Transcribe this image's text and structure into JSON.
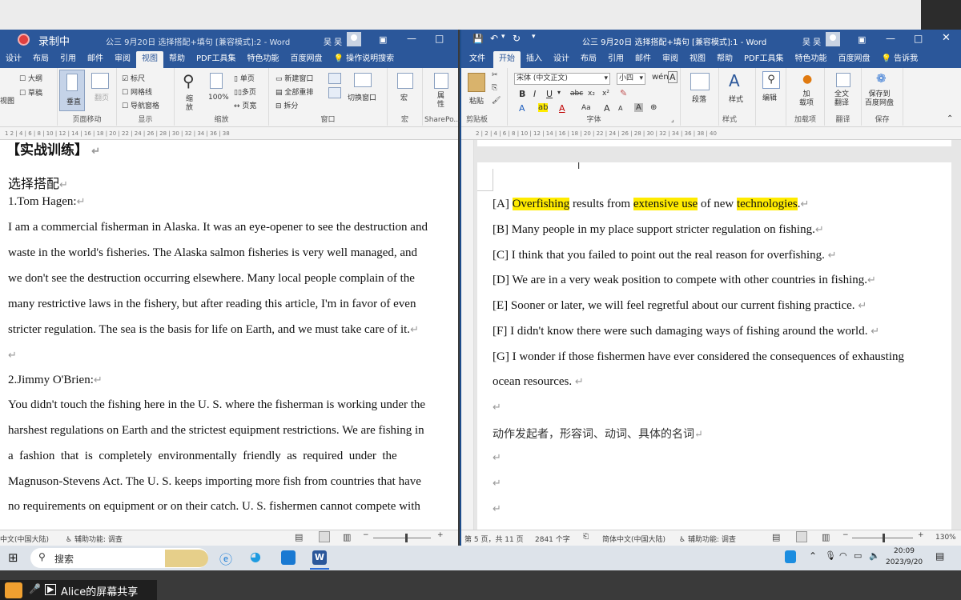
{
  "overlay": {
    "recording_label": "录制中",
    "share_label": "Alice的屏幕共享"
  },
  "left_window": {
    "title": "公三 9月20日 选择搭配+填句 [兼容模式]:2 - Word",
    "user": "吴 吴",
    "tabs": [
      "设计",
      "布局",
      "引用",
      "邮件",
      "审阅",
      "视图",
      "帮助",
      "PDF工具集",
      "特色功能",
      "百度网盘",
      "操作说明搜索"
    ],
    "active_tab": "视图",
    "ribbon": {
      "views": [
        "大纲",
        "草稿"
      ],
      "view_label": "视图",
      "page_move_label": "页面移动",
      "vertical_label": "垂直",
      "side_label": "翻页",
      "show_items": [
        "标尺",
        "网格线",
        "导航窗格"
      ],
      "show_label": "显示",
      "zoom_label": "缩放",
      "zoom_items": [
        "缩放",
        "100%",
        "单页",
        "多页",
        "页宽"
      ],
      "window_items": [
        "新建窗口",
        "全部重排",
        "拆分",
        "切换窗口"
      ],
      "window_label": "窗口",
      "macro_label": "宏",
      "macro_item": "宏",
      "attr_item": "属性",
      "sharepoint_label": "SharePo..."
    },
    "ruler_text": "1 2 | 4 | 6 | 8 | 10 | 12 | 14 | 16 | 18 | 20 | 22 | 24 | 26 | 28 | 30 | 32 | 34 | 36 | 38",
    "doc": {
      "heading": "【实战训练】",
      "section": "选择搭配",
      "p1_name": "1.Tom Hagen:",
      "p1_lines": [
        "I am a commercial fisherman in Alaska. It was an eye-opener to see the destruction and",
        "waste in the world's fisheries. The Alaska salmon fisheries is very well managed, and",
        "we don't see the destruction occurring elsewhere. Many local people complain of the",
        "many restrictive laws in the fishery, but after reading this article, I'm in favor of even",
        "stricter regulation. The sea is the basis for life on Earth, and we must take care of it."
      ],
      "p2_name": "2.Jimmy O'Brien:",
      "p2_lines": [
        "You didn't touch the fishing here in the U. S. where the fisherman is working under the",
        "harshest regulations on Earth and the strictest equipment restrictions. We are fishing in",
        "a  fashion  that  is  completely  environmentally  friendly  as  required  under  the",
        "Magnuson-Stevens Act. The U. S. keeps importing more fish from countries that have",
        "no requirements on equipment or on their catch. U. S. fishermen cannot compete with"
      ]
    },
    "status": {
      "language": "中文(中国大陆)",
      "accessibility": "辅助功能: 调查"
    }
  },
  "right_window": {
    "title": "公三 9月20日 选择搭配+填句 [兼容模式]:1 - Word",
    "user": "吴 吴",
    "tabs": [
      "文件",
      "开始",
      "插入",
      "设计",
      "布局",
      "引用",
      "邮件",
      "审阅",
      "视图",
      "帮助",
      "PDF工具集",
      "特色功能",
      "百度网盘",
      "告诉我"
    ],
    "active_tab": "开始",
    "ribbon": {
      "paste_label": "粘贴",
      "clipboard_label": "剪贴板",
      "font_name": "宋体 (中文正文)",
      "font_size": "小四",
      "font_label": "字体",
      "paragraph_label": "段落",
      "style_item": "样式",
      "style_label": "样式",
      "edit_item": "编辑",
      "addin_item": "加\n载项",
      "addin_label": "加载项",
      "translate_item": "全文\n翻译",
      "translate_label": "翻译",
      "save_item": "保存到\n百度网盘",
      "save_label": "保存"
    },
    "ruler_text": "2 | 2 | 4 | 6 | 8 | 10 | 12 | 14 | 16 | 18 | 20 | 22 | 24 | 26 | 28 | 30 | 32 | 34 | 36 | 38 | 40",
    "doc": {
      "options": [
        {
          "label": "[A] ",
          "parts": [
            {
              "t": "Overfishing",
              "hl": true
            },
            {
              "t": " results from ",
              "hl": false
            },
            {
              "t": "extensive use",
              "hl": true
            },
            {
              "t": " of new ",
              "hl": false
            },
            {
              "t": "technologies",
              "hl": true
            },
            {
              "t": ".",
              "hl": false
            }
          ]
        },
        {
          "label": "[B] ",
          "parts": [
            {
              "t": "Many people in my place support stricter regulation on fishing.",
              "hl": false
            }
          ]
        },
        {
          "label": "[C] ",
          "parts": [
            {
              "t": "I think that you failed to point out the real reason for overfishing.",
              "hl": false
            }
          ]
        },
        {
          "label": "[D] ",
          "parts": [
            {
              "t": "We are in a very weak position to compete with other countries in fishing.",
              "hl": false
            }
          ]
        },
        {
          "label": "[E] ",
          "parts": [
            {
              "t": "Sooner or later, we will feel regretful about our current fishing practice.",
              "hl": false
            }
          ]
        },
        {
          "label": "[F] ",
          "parts": [
            {
              "t": "I didn't know there were such damaging ways of fishing around the world.",
              "hl": false
            }
          ]
        },
        {
          "label": "[G] ",
          "parts": [
            {
              "t": "I wonder if those fishermen have ever considered the consequences of exhausting",
              "hl": false
            }
          ]
        }
      ],
      "g_cont": "ocean resources.",
      "note": "动作发起者，形容词、动词、具体的名词"
    },
    "status": {
      "page": "第 5 页，共 11 页",
      "words": "2841 个字",
      "language": "简体中文(中国大陆)",
      "accessibility": "辅助功能: 调查",
      "zoom": "130%"
    }
  },
  "taskbar": {
    "search_label": "搜索",
    "time": "20:09",
    "date": "2023/9/20"
  }
}
